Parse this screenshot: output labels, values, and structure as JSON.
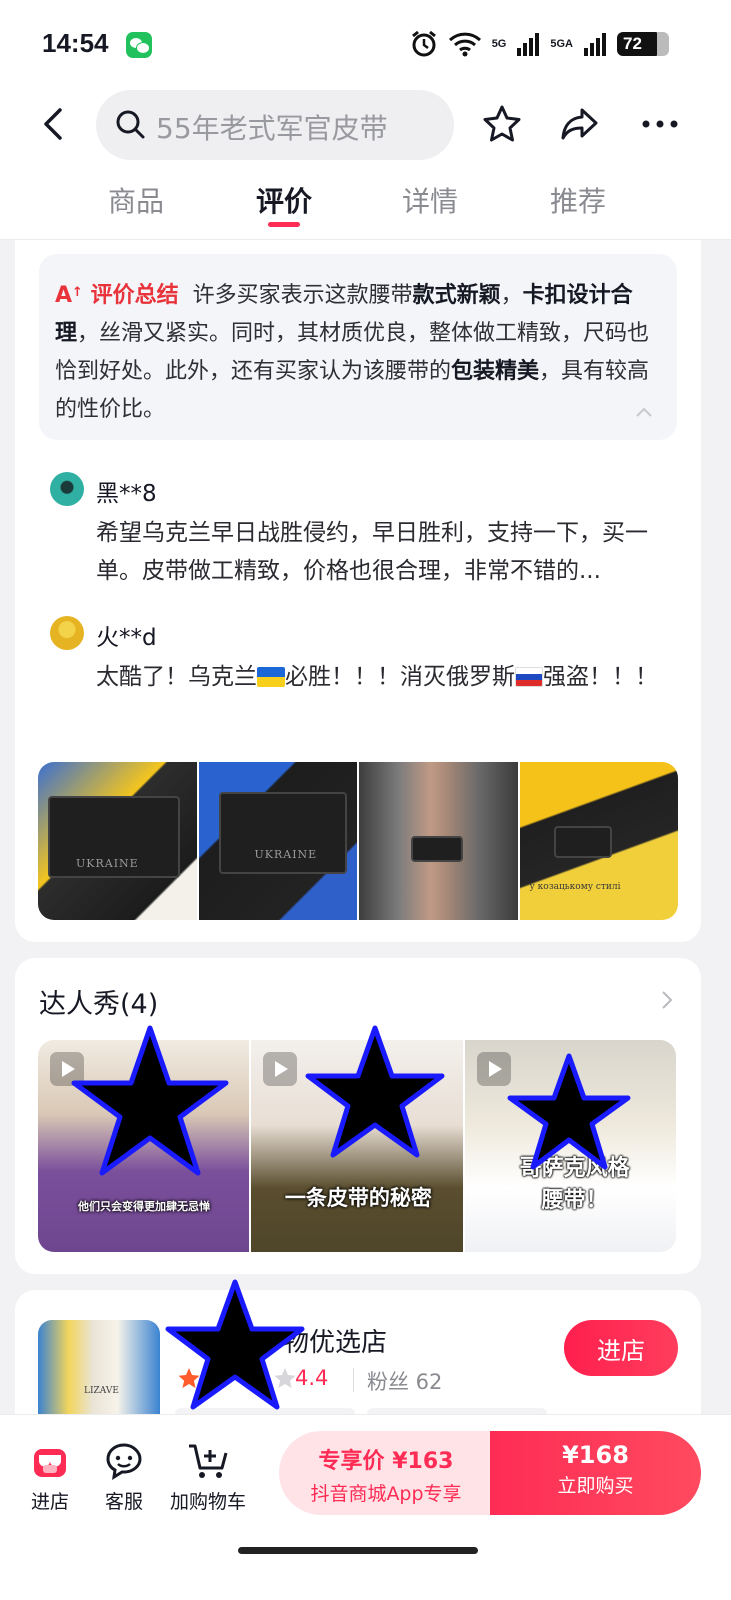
{
  "status_bar": {
    "time": "14:54",
    "network_1": "5G",
    "network_2": "5GA",
    "battery": "72"
  },
  "header": {
    "search_text": "55年老式军官皮带"
  },
  "tabs": [
    {
      "label": "商品",
      "active": false
    },
    {
      "label": "评价",
      "active": true
    },
    {
      "label": "详情",
      "active": false
    },
    {
      "label": "推荐",
      "active": false
    }
  ],
  "ai_summary": {
    "tag": "评价总结",
    "segments": [
      {
        "text": "许多买家表示这款腰带",
        "bold": false
      },
      {
        "text": "款式新颖",
        "bold": true
      },
      {
        "text": "，",
        "bold": false
      },
      {
        "text": "卡扣设计合理",
        "bold": true
      },
      {
        "text": "，丝滑又紧实。同时，其材质优良，整体做工精致，尺码也恰到好处。此外，还有买家认为该腰带的",
        "bold": false
      },
      {
        "text": "包装精美",
        "bold": true
      },
      {
        "text": "，具有较高的性价比。",
        "bold": false
      }
    ]
  },
  "comments": [
    {
      "user": "黑**8",
      "text": "希望乌克兰早日战胜侵约，早日胜利，支持一下，买一单。皮带做工精致，价格也很合理，非常不错的..."
    },
    {
      "user": "火**d",
      "text_parts": [
        "太酷了！乌克兰",
        "必胜！！！消灭俄罗斯",
        "强盗！！！"
      ]
    }
  ],
  "review_photos": [
    {
      "caption": "UKRAINE"
    },
    {
      "caption": "UKRAINE"
    },
    {
      "caption": ""
    },
    {
      "caption": "у козацькому стилі"
    }
  ],
  "influencer": {
    "title": "达人秀(4)",
    "videos": [
      {
        "caption": "他们只会变得更加肆无忌惮"
      },
      {
        "caption": "一条皮带的秘密"
      },
      {
        "caption": "哥萨克风格\n腰带！"
      }
    ]
  },
  "shop": {
    "name": "物优选店",
    "rating": "4.4",
    "fans": "粉丝 62",
    "enter_label": "进店",
    "thumb_label": "LIZAVE"
  },
  "bottom_bar": {
    "shop_label": "进店",
    "service_label": "客服",
    "cart_label": "加购物车",
    "promo_price": "专享价 ¥163",
    "promo_sub": "抖音商城App专享",
    "buy_price": "¥168",
    "buy_label": "立即购买"
  },
  "colors": {
    "accent": "#fe2c55",
    "redaction_fill": "#000000",
    "redaction_stroke": "#1a1aff"
  }
}
